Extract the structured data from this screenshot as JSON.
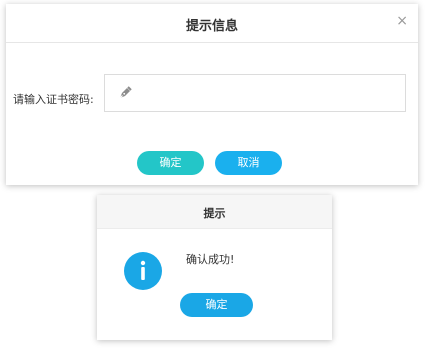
{
  "dialog1": {
    "title": "提示信息",
    "close_glyph": "×",
    "password_label": "请输入证书密码:",
    "password_value": "",
    "input_icon": "pen-icon",
    "confirm_label": "确定",
    "cancel_label": "取消"
  },
  "dialog2": {
    "title": "提示",
    "icon": "info-icon",
    "message": "确认成功!",
    "confirm_label": "确定"
  },
  "colors": {
    "confirm_teal": "#23c6c8",
    "button_blue": "#1ab0ee",
    "info_blue": "#1aa7e6"
  }
}
